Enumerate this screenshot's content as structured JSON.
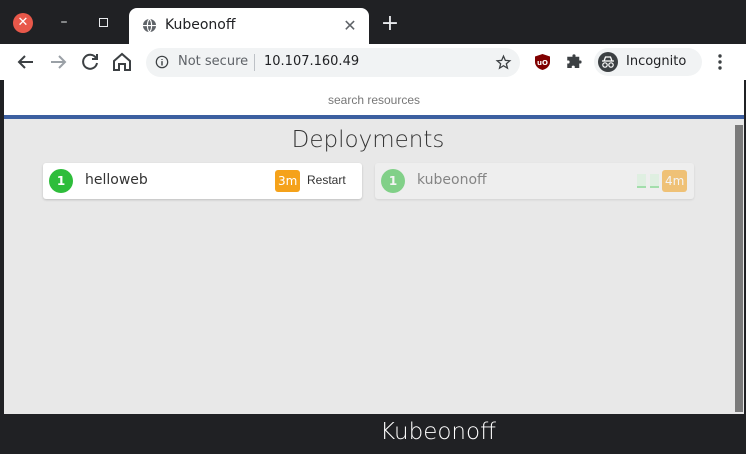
{
  "browser": {
    "tab_title": "Kubeonoff",
    "security_label": "Not secure",
    "url": "10.107.160.49",
    "profile_label": "Incognito"
  },
  "page": {
    "search_placeholder": "search resources",
    "heading": "Deployments",
    "footer_title": "Kubeonoff"
  },
  "deployments": [
    {
      "replicas": "1",
      "name": "helloweb",
      "age": "3m",
      "action_label": "Restart",
      "state": "active"
    },
    {
      "replicas": "1",
      "name": "kubeonoff",
      "age": "4m",
      "state": "faded"
    }
  ],
  "colors": {
    "replica_badge": "#2ebd3b",
    "age_badge": "#f5a21a",
    "accent_bar": "#3c5fa0"
  }
}
